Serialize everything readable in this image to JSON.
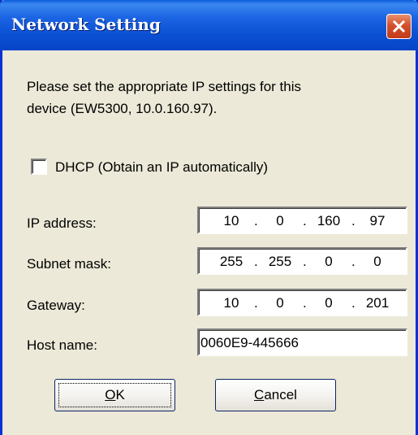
{
  "window": {
    "title": "Network Setting"
  },
  "message": {
    "line1": "Please set the appropriate IP settings for this",
    "line2": "device (EW5300, 10.0.160.97)."
  },
  "dhcp": {
    "label": "DHCP (Obtain an IP automatically)",
    "checked": false
  },
  "fields": {
    "ip": {
      "label": "IP address:",
      "octets": [
        "10",
        "0",
        "160",
        "97"
      ]
    },
    "subnet": {
      "label": "Subnet mask:",
      "octets": [
        "255",
        "255",
        "0",
        "0"
      ]
    },
    "gateway": {
      "label": "Gateway:",
      "octets": [
        "10",
        "0",
        "0",
        "201"
      ]
    },
    "host": {
      "label": "Host name:",
      "value": "0060E9-445666"
    }
  },
  "buttons": {
    "ok": {
      "mnemonic": "O",
      "rest": "K"
    },
    "cancel": {
      "mnemonic": "C",
      "rest": "ancel"
    }
  },
  "colors": {
    "titlebar": "#0a4fd2",
    "close": "#d4502b",
    "face": "#ece9d8"
  },
  "icons": {
    "close": "close-icon"
  }
}
